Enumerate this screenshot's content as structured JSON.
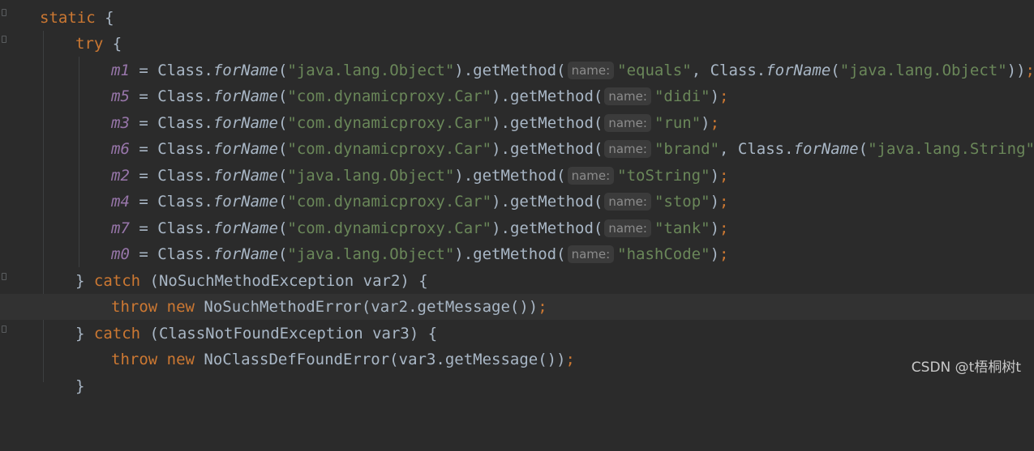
{
  "editor": {
    "lines": {
      "static": {
        "kw": "static",
        "brace": " {"
      },
      "try": {
        "kw": "try",
        "brace": " {"
      },
      "assignments": [
        {
          "var": "m1",
          "cls": "java.lang.Object",
          "name": "equals",
          "extra": "java.lang.Object"
        },
        {
          "var": "m5",
          "cls": "com.dynamicproxy.Car",
          "name": "didi"
        },
        {
          "var": "m3",
          "cls": "com.dynamicproxy.Car",
          "name": "run"
        },
        {
          "var": "m6",
          "cls": "com.dynamicproxy.Car",
          "name": "brand",
          "extra": "java.lang.String"
        },
        {
          "var": "m2",
          "cls": "java.lang.Object",
          "name": "toString"
        },
        {
          "var": "m4",
          "cls": "com.dynamicproxy.Car",
          "name": "stop"
        },
        {
          "var": "m7",
          "cls": "com.dynamicproxy.Car",
          "name": "tank"
        },
        {
          "var": "m0",
          "cls": "java.lang.Object",
          "name": "hashCode"
        }
      ],
      "catch1": {
        "close": "} ",
        "kw": "catch",
        "rest": " (NoSuchMethodException var2) {"
      },
      "throw1": {
        "kw1": "throw",
        "kw2": " new",
        "rest": " NoSuchMethodError(var2.getMessage())",
        "semi": ";"
      },
      "catch2": {
        "close": "} ",
        "kw": "catch",
        "rest": " (ClassNotFoundException var3) {"
      },
      "throw2": {
        "kw1": "throw",
        "kw2": " new",
        "rest": " NoClassDefFoundError(var3.getMessage())",
        "semi": ";"
      },
      "last": {
        "text": "}"
      }
    },
    "tokens": {
      "eq": " = ",
      "class": "Class.",
      "forName": "forName",
      "getMethod": ").getMethod(",
      "hint": "name:",
      "comma": ", ",
      "close_single": ")",
      "close_double": "))",
      "semi": ";"
    }
  },
  "watermark": "CSDN @t梧桐树t"
}
